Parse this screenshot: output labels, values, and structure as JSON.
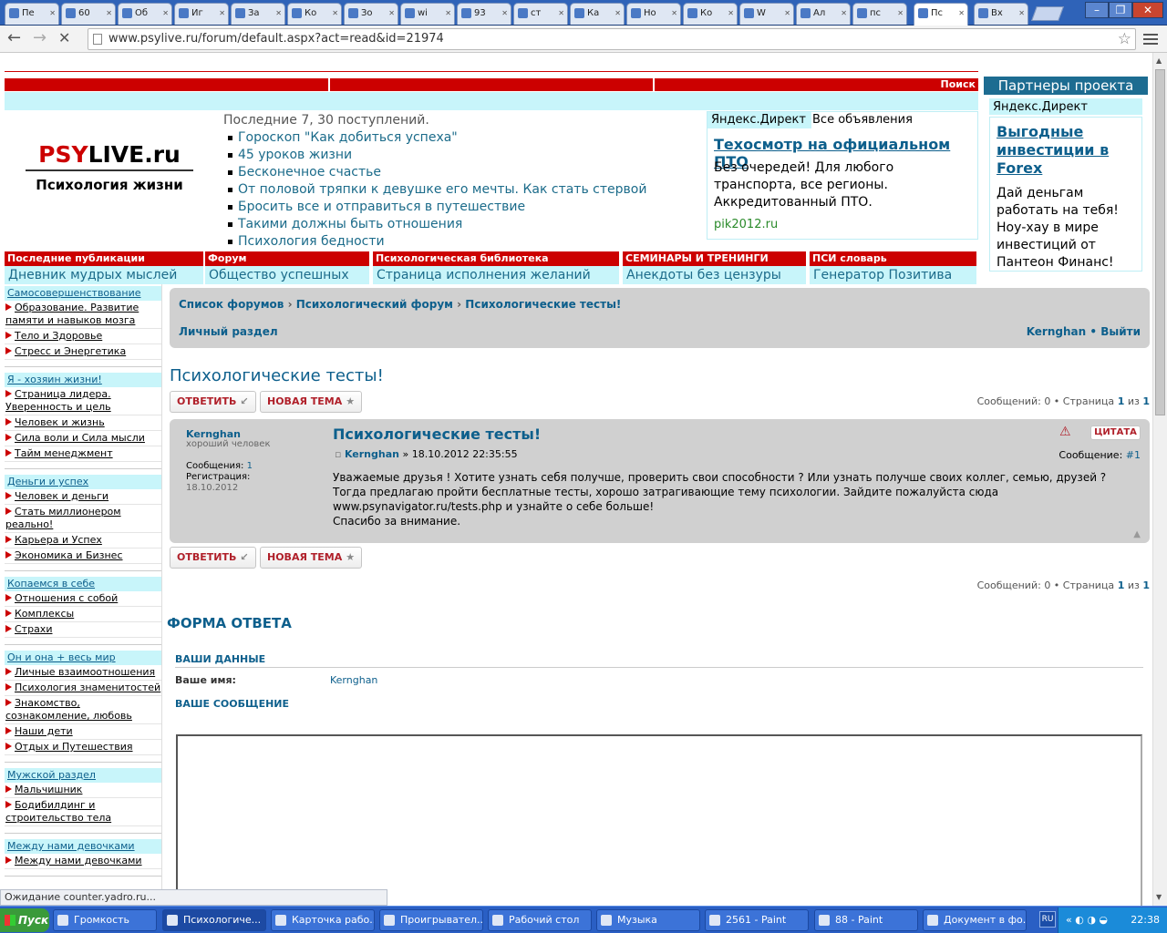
{
  "browser": {
    "tabs": [
      {
        "label": "Пе",
        "active": false
      },
      {
        "label": "60",
        "active": false
      },
      {
        "label": "Об",
        "active": false
      },
      {
        "label": "Иг",
        "active": false
      },
      {
        "label": "За",
        "active": false
      },
      {
        "label": "Ко",
        "active": false
      },
      {
        "label": "Зо",
        "active": false
      },
      {
        "label": "wi",
        "active": false
      },
      {
        "label": "93",
        "active": false
      },
      {
        "label": "ст",
        "active": false
      },
      {
        "label": "Ка",
        "active": false
      },
      {
        "label": "Но",
        "active": false
      },
      {
        "label": "Ко",
        "active": false
      },
      {
        "label": "W",
        "active": false
      },
      {
        "label": "Ал",
        "active": false
      },
      {
        "label": "пс",
        "active": false
      },
      {
        "label": "Пс",
        "active": true
      },
      {
        "label": "Вх",
        "active": false
      }
    ],
    "url": "www.psylive.ru/forum/default.aspx?act=read&id=21974",
    "status": "Ожидание counter.yadro.ru..."
  },
  "header": {
    "search_label": "Поиск",
    "logo_text": "PSYLIVE.ru",
    "logo_subtitle": "Психология жизни",
    "recent_title": "Последние 7, 30 поступлений.",
    "recent_items": [
      "Гороскоп \"Как добиться успеха\"",
      "45 уроков жизни",
      "Бесконечное счастье",
      "От половой тряпки к девушке его мечты. Как стать стервой",
      "Бросить все и отправиться в путешествие",
      "Такими должны быть отношения",
      "Психология бедности"
    ]
  },
  "ad_center": {
    "yandex_label": "Яндекс.Директ",
    "all_ads": "Все объявления",
    "title": "Техосмотр на официальном ПТО",
    "body": "Без очередей! Для любого транспорта, все регионы. Аккредитованный ПТО.",
    "domain": "pik2012.ru"
  },
  "partners": {
    "title": "Партнеры проекта",
    "yandex_label": "Яндекс.Директ",
    "ad_title": "Выгодные инвестиции в Forex",
    "ad_body": "Дай деньгам работать на тебя! Ноу-хау в мире инвестиций от Пантеон Финанс!"
  },
  "topnav": [
    {
      "head": "Последние публикации",
      "link": "Дневник мудрых мыслей"
    },
    {
      "head": "Форум",
      "link": "Общество успешных"
    },
    {
      "head": "Психологическая библиотека",
      "link": "Страница исполнения желаний"
    },
    {
      "head": "СЕМИНАРЫ И ТРЕНИНГИ",
      "link": "Анекдоты без цензуры"
    },
    {
      "head": "ПСИ словарь",
      "link": "Генератор Позитива"
    }
  ],
  "sidebar": {
    "sections": [
      {
        "title": "Самосовершенствование",
        "items": [
          "Образование. Развитие памяти и навыков мозга",
          "Тело и Здоровье",
          "Стресс и Энергетика"
        ]
      },
      {
        "title": "Я - хозяин жизни!",
        "items": [
          "Страница лидера. Уверенность и цель",
          "Человек и жизнь",
          "Сила воли и Сила мысли",
          "Тайм менеджмент"
        ]
      },
      {
        "title": "Деньги и успех",
        "items": [
          "Человек и деньги",
          "Стать миллионером реально!",
          "Карьера и Успех",
          "Экономика и Бизнес"
        ]
      },
      {
        "title": "Копаемся в себе",
        "items": [
          "Отношения с собой",
          "Комплексы",
          "Страхи"
        ]
      },
      {
        "title": "Он и она + весь мир",
        "items": [
          "Личные взаимоотношения",
          "Психология знаменитостей",
          "Знакомство, сознакомление, любовь",
          "Наши дети",
          "Отдых и Путешествия"
        ]
      },
      {
        "title": "Мужской раздел",
        "items": [
          "Мальчишник",
          "Бодибилдинг и строительство тела"
        ]
      },
      {
        "title": "Между нами девочками",
        "items": [
          "Между нами девочками"
        ]
      }
    ]
  },
  "forum": {
    "breadcrumb": [
      "Список форумов",
      "Психологический форум",
      "Психологические тесты!"
    ],
    "personal": "Личный раздел",
    "user": "Kernghan",
    "logout": "Выйти",
    "topic_title": "Психологические тесты!",
    "reply_btn": "ОТВЕТИТЬ",
    "new_topic_btn": "НОВАЯ ТЕМА",
    "pagination_top": {
      "msgs_label": "Сообщений:",
      "msgs": "0",
      "page_label": "Страница",
      "page": "1",
      "of_label": "из",
      "total": "1"
    },
    "post": {
      "author": "Kernghan",
      "rank": "хороший человек",
      "posts_label": "Сообщения:",
      "posts": "1",
      "reg_label": "Регистрация:",
      "reg_date": "18.10.2012",
      "title": "Психологические тесты!",
      "meta_date": "» 18.10.2012 22:35:55",
      "quote_btn": "ЦИТАТА",
      "msg_label": "Сообщение:",
      "msg_num": "#1",
      "body_lines": [
        "Уважаемые друзья ! Хотите узнать себя получше, проверить свои способности ? Или узнать получше своих коллег, семью, друзей ?",
        "Тогда предлагаю пройти бесплатные тесты, хорошо затрагивающие тему психологии. Зайдите пожалуйста сюда",
        "www.psynavigator.ru/tests.php и узнайте о себе больше!",
        "Спасибо за внимание."
      ]
    },
    "reply_form": {
      "title": "ФОРМА ОТВЕТА",
      "your_data": "ВАШИ ДАННЫЕ",
      "name_label": "Ваше имя:",
      "name_value": "Kernghan",
      "message_label": "ВАШЕ СООБЩЕНИЕ"
    }
  },
  "taskbar": {
    "start": "Пуск",
    "items": [
      {
        "label": "Громкость",
        "active": false
      },
      {
        "label": "Психологиче...",
        "active": true
      },
      {
        "label": "Карточка рабо...",
        "active": false
      },
      {
        "label": "Проигрывател...",
        "active": false
      },
      {
        "label": "Рабочий стол",
        "active": false
      },
      {
        "label": "Музыка",
        "active": false
      },
      {
        "label": "2561 - Paint",
        "active": false
      },
      {
        "label": "88 - Paint",
        "active": false
      },
      {
        "label": "Документ в фо...",
        "active": false
      }
    ],
    "lang": "RU",
    "clock": "22:38"
  }
}
